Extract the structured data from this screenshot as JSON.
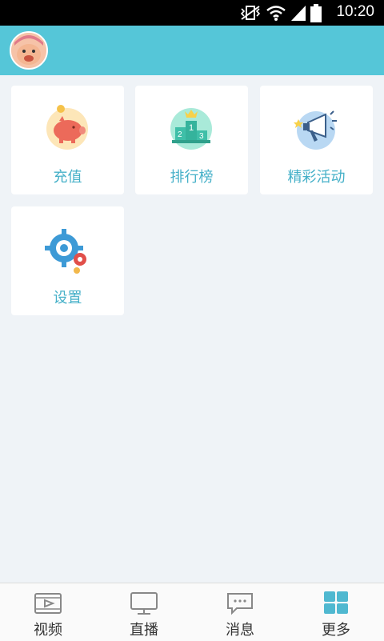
{
  "status_bar": {
    "time": "10:20"
  },
  "header": {
    "avatar": "user-avatar"
  },
  "grid": [
    {
      "label": "充值",
      "icon": "piggy-bank-icon"
    },
    {
      "label": "排行榜",
      "icon": "podium-icon"
    },
    {
      "label": "精彩活动",
      "icon": "megaphone-icon"
    },
    {
      "label": "设置",
      "icon": "gear-icon"
    }
  ],
  "tabs": [
    {
      "label": "视频",
      "icon": "video-icon"
    },
    {
      "label": "直播",
      "icon": "tv-icon"
    },
    {
      "label": "消息",
      "icon": "chat-icon"
    },
    {
      "label": "更多",
      "icon": "grid-icon",
      "active": true
    }
  ],
  "colors": {
    "accent": "#55c6d8",
    "label": "#45b0c8",
    "background": "#eff3f7"
  }
}
